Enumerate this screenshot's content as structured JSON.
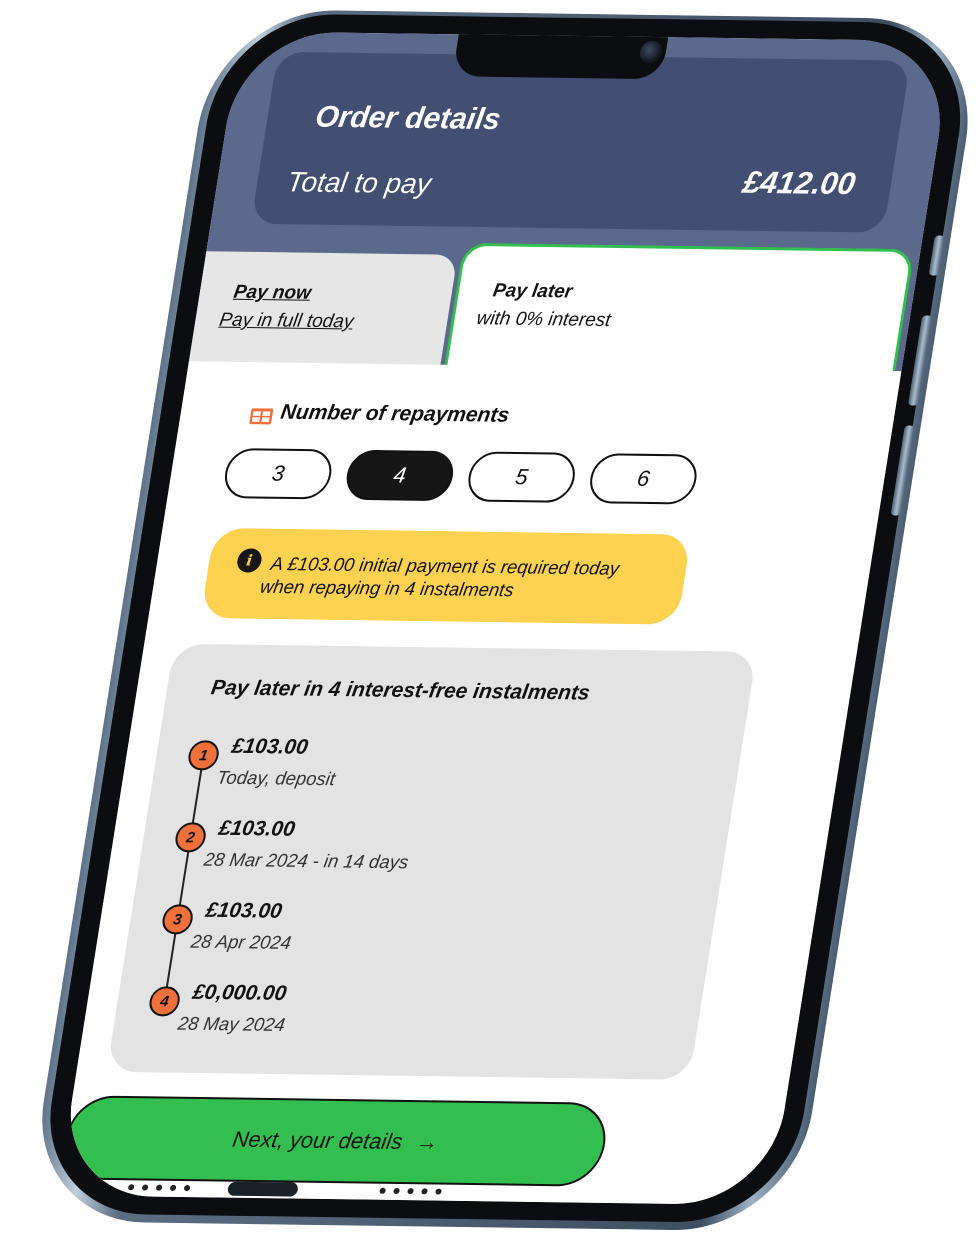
{
  "order": {
    "title": "Order details",
    "total_label": "Total to pay",
    "total_amount": "£412.00"
  },
  "tabs": [
    {
      "title": "Pay now",
      "subtitle": "Pay in full today",
      "selected": false
    },
    {
      "title": "Pay later",
      "subtitle": "with 0% interest",
      "selected": true
    }
  ],
  "repayments": {
    "title": "Number of repayments",
    "icon": "calendar-grid-icon",
    "options": [
      "3",
      "4",
      "5",
      "6"
    ],
    "selected": "4"
  },
  "notice": {
    "icon": "info-icon",
    "icon_glyph": "i",
    "line1": "A £103.00 initial payment is required today",
    "line2": "when repaying in 4 instalments"
  },
  "schedule": {
    "title": "Pay later in 4 interest-free instalments",
    "instalments": [
      {
        "number": "1",
        "amount": "£103.00",
        "date": "Today, deposit"
      },
      {
        "number": "2",
        "amount": "£103.00",
        "date": "28 Mar 2024 - in 14 days"
      },
      {
        "number": "3",
        "amount": "£103.00",
        "date": "28 Apr 2024"
      },
      {
        "number": "4",
        "amount": "£0,000.00",
        "date": "28 May 2024"
      }
    ]
  },
  "cta": {
    "label": "Next, your details",
    "arrow": "→"
  },
  "colors": {
    "header_band": "#5b6a8c",
    "order_card": "#424f72",
    "accent_green": "#33bf4f",
    "notice_yellow": "#fdd250",
    "badge_orange": "#f0703b",
    "schedule_bg": "#e3e3e3"
  }
}
